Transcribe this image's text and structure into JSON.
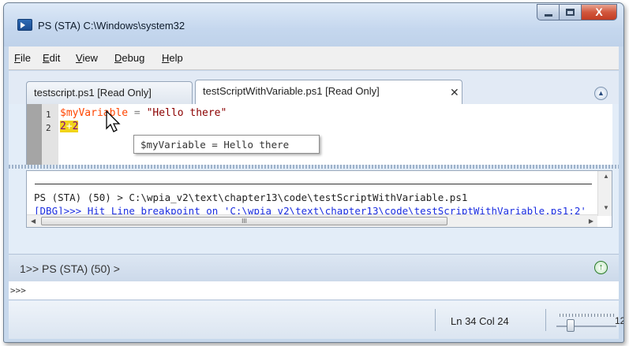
{
  "window": {
    "title": "PS (STA)  C:\\Windows\\system32",
    "close_label": "X"
  },
  "menu": {
    "items": [
      {
        "accel": "F",
        "rest": "ile"
      },
      {
        "accel": "E",
        "rest": "dit"
      },
      {
        "accel": "V",
        "rest": "iew"
      },
      {
        "accel": "D",
        "rest": "ebug"
      },
      {
        "accel": "H",
        "rest": "elp"
      }
    ]
  },
  "tabs": [
    {
      "label": "testscript.ps1 [Read Only]",
      "active": false
    },
    {
      "label": "testScriptWithVariable.ps1 [Read Only]",
      "active": true,
      "close": "✕"
    }
  ],
  "editor": {
    "lines": [
      {
        "number": "1",
        "var": "$myVariable",
        "op": " = ",
        "str": "\"Hello there\""
      },
      {
        "number": "2",
        "expr_left": "2",
        "expr_op": "+",
        "expr_right": "2"
      }
    ],
    "tooltip": "$myVariable = Hello there"
  },
  "output": {
    "ps_line": "PS (STA) (50) > C:\\wpia_v2\\text\\chapter13\\code\\testScriptWithVariable.ps1",
    "dbg_line": "[DBG]>>> Hit Line breakpoint on 'C:\\wpia_v2\\text\\chapter13\\code\\testScriptWithVariable.ps1:2'",
    "hscroll_grip": "III"
  },
  "prompt": {
    "text": "1>> PS (STA) (50) >",
    "input_prompt": ">>>"
  },
  "status": {
    "position": "Ln 34  Col 24",
    "zoom": "12"
  },
  "colors": {
    "variable": "#ff4500",
    "string": "#8b0000",
    "debug_text": "#1a2de0",
    "breakpoint_highlight": "#f1d31a"
  },
  "icons": [
    "powershell-app-icon",
    "minimize-icon",
    "maximize-icon",
    "close-icon",
    "collapse-up-icon",
    "mouse-pointer-icon",
    "run-up-icon"
  ]
}
